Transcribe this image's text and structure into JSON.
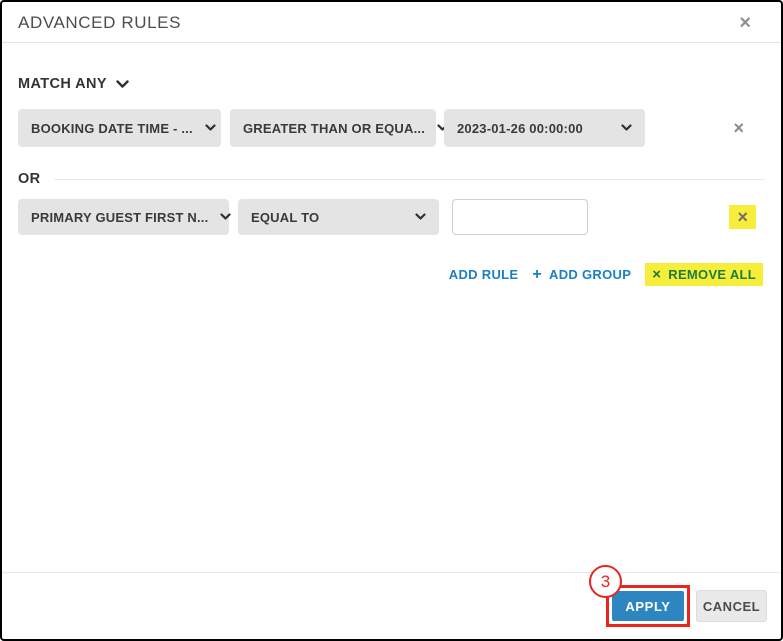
{
  "modal": {
    "title": "ADVANCED RULES"
  },
  "icons": {
    "close": "×",
    "remove": "×",
    "remove_all_x": "×",
    "plus": "+",
    "chevron_down": "⌄"
  },
  "match": {
    "label": "MATCH ANY"
  },
  "group": {
    "or_label": "OR"
  },
  "rows": [
    {
      "field": "BOOKING DATE TIME - ...",
      "operator": "GREATER THAN OR EQUA...",
      "value": "2023-01-26 00:00:00"
    },
    {
      "field": "PRIMARY GUEST FIRST N...",
      "operator": "EQUAL TO",
      "value": "",
      "placeholder": ""
    }
  ],
  "actions": {
    "add_rule": "ADD RULE",
    "add_group": "ADD GROUP",
    "remove_all": "REMOVE ALL"
  },
  "footer": {
    "apply": "APPLY",
    "cancel": "CANCEL"
  },
  "annotation": {
    "step": "3"
  },
  "colors": {
    "apply_blue": "#2e86c1",
    "link_blue": "#1b7fc4",
    "highlight_yellow": "#f6ee3a",
    "annotation_red": "#e8251f",
    "remove_all_green": "#1f7c3d",
    "dropdown_gray": "#e4e4e4"
  }
}
